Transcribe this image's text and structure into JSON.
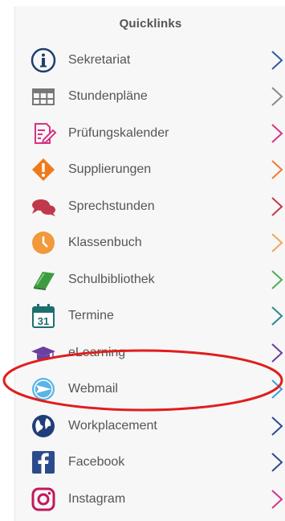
{
  "quicklinks": {
    "title": "Quicklinks",
    "items": [
      {
        "label": "Sekretariat",
        "icon": "info-icon",
        "chevron_color": "#2b5c9e"
      },
      {
        "label": "Stundenpläne",
        "icon": "table-grid-icon",
        "chevron_color": "#888888"
      },
      {
        "label": "Prüfungskalender",
        "icon": "document-edit-icon",
        "chevron_color": "#d63384"
      },
      {
        "label": "Supplierungen",
        "icon": "warning-diamond-icon",
        "chevron_color": "#f07a35"
      },
      {
        "label": "Sprechstunden",
        "icon": "speech-bubbles-icon",
        "chevron_color": "#c0394b"
      },
      {
        "label": "Klassenbuch",
        "icon": "clock-icon",
        "chevron_color": "#f2a65a"
      },
      {
        "label": "Schulbibliothek",
        "icon": "book-icon",
        "chevron_color": "#4caf50"
      },
      {
        "label": "Termine",
        "icon": "calendar-icon",
        "chevron_color": "#2a8a8a"
      },
      {
        "label": "eLearning",
        "icon": "graduation-cap-icon",
        "chevron_color": "#6a3fa0"
      },
      {
        "label": "Webmail",
        "icon": "mail-globe-icon",
        "chevron_color": "#3aa0d8"
      },
      {
        "label": "Workplacement",
        "icon": "globe-icon",
        "chevron_color": "#2b4c8c"
      },
      {
        "label": "Facebook",
        "icon": "facebook-icon",
        "chevron_color": "#2b4c8c"
      },
      {
        "label": "Instagram",
        "icon": "instagram-icon",
        "chevron_color": "#d63384"
      }
    ],
    "calendar_day": "31"
  },
  "highlight_color": "#e11d1d"
}
